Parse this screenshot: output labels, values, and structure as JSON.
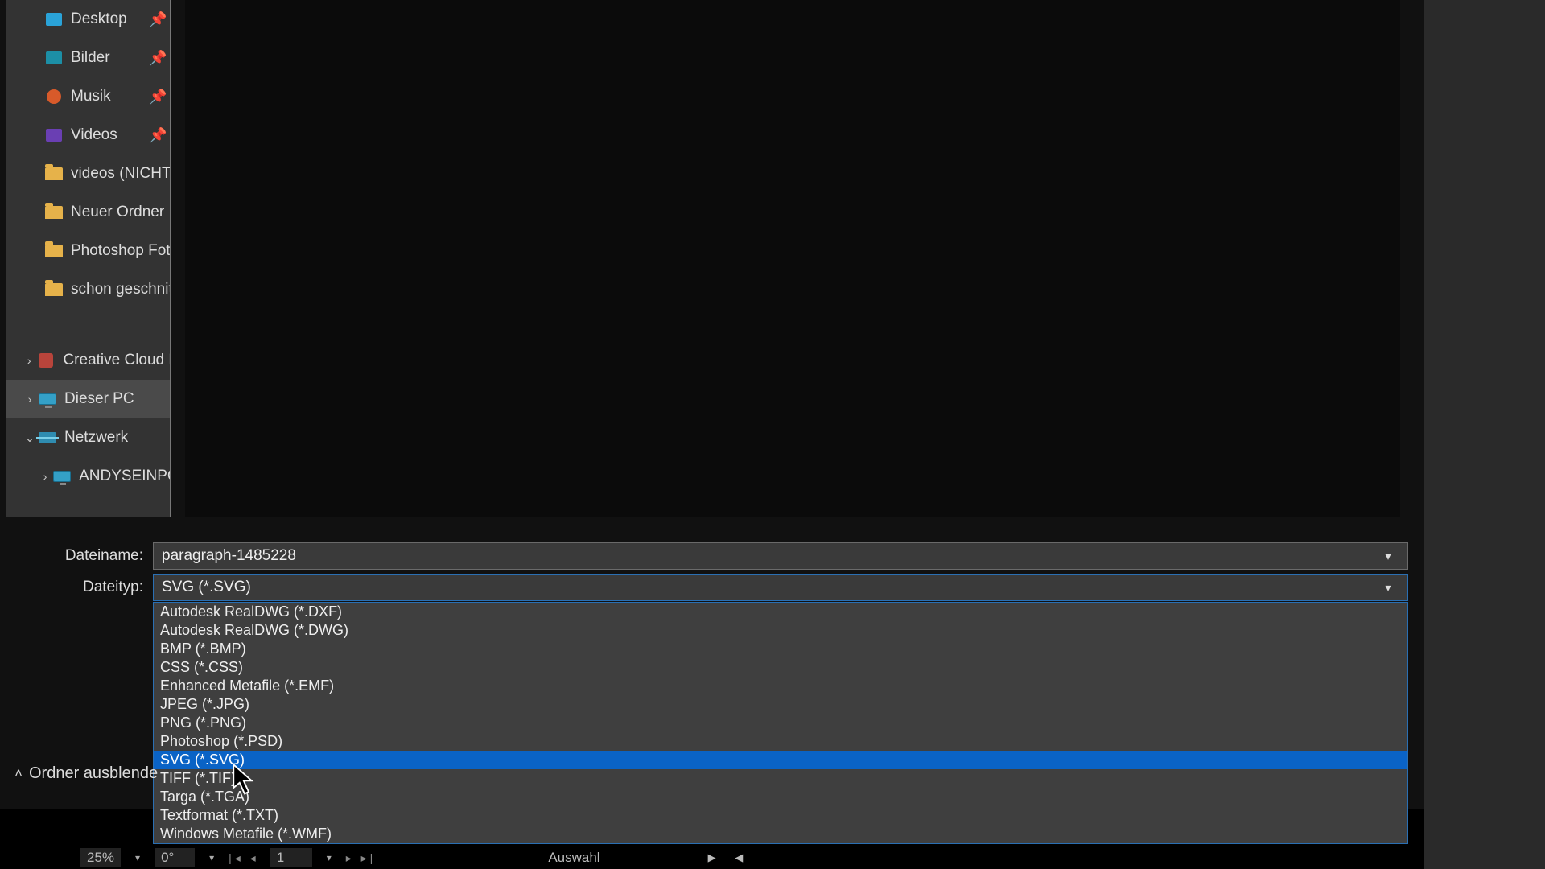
{
  "sidebar": {
    "items": [
      {
        "label": "Desktop",
        "icon": "blue",
        "pinned": true
      },
      {
        "label": "Bilder",
        "icon": "teal",
        "pinned": true
      },
      {
        "label": "Musik",
        "icon": "orange",
        "pinned": true
      },
      {
        "label": "Videos",
        "icon": "purple",
        "pinned": true
      },
      {
        "label": "videos (NICHT F",
        "icon": "folder",
        "pinned": false
      },
      {
        "label": "Neuer Ordner",
        "icon": "folder",
        "pinned": false
      },
      {
        "label": "Photoshop Foto",
        "icon": "folder",
        "pinned": false
      },
      {
        "label": "schon geschnitt",
        "icon": "folder",
        "pinned": false
      }
    ],
    "roots": [
      {
        "label": "Creative Cloud F",
        "icon": "ccloud",
        "expander": "›"
      },
      {
        "label": "Dieser PC",
        "icon": "pc",
        "expander": "›",
        "selected": true
      },
      {
        "label": "Netzwerk",
        "icon": "net",
        "expander": "⌄"
      }
    ],
    "network_child": {
      "label": "ANDYSEINPC",
      "icon": "pc",
      "expander": "›"
    }
  },
  "form": {
    "name_label": "Dateiname:",
    "name_value": "paragraph-1485228",
    "type_label": "Dateityp:",
    "type_value": "SVG (*.SVG)"
  },
  "dropdown": {
    "selected_index": 8,
    "options": [
      "Autodesk RealDWG (*.DXF)",
      "Autodesk RealDWG (*.DWG)",
      "BMP (*.BMP)",
      "CSS (*.CSS)",
      "Enhanced Metafile (*.EMF)",
      "JPEG (*.JPG)",
      "PNG (*.PNG)",
      "Photoshop (*.PSD)",
      "SVG (*.SVG)",
      "TIFF (*.TIF)",
      "Targa (*.TGA)",
      "Textformat (*.TXT)",
      "Windows Metafile (*.WMF)"
    ]
  },
  "hide_folders_label": "Ordner ausblende",
  "statusbar": {
    "zoom": "25%",
    "rotation": "0°",
    "page": "1",
    "selection_label": "Auswahl"
  }
}
